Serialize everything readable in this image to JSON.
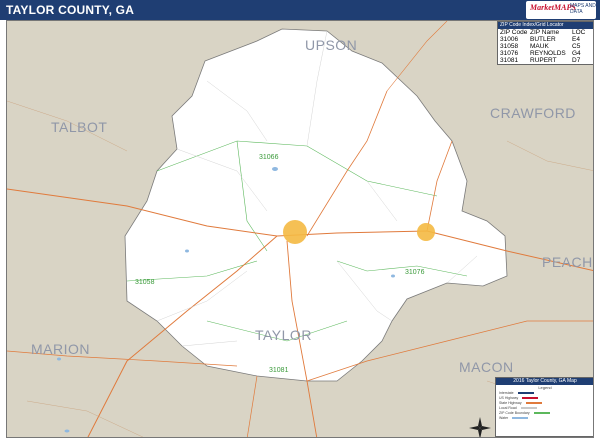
{
  "header": {
    "title": "TAYLOR COUNTY, GA"
  },
  "logo": {
    "text": "MarketMAPS",
    "subtext": "MAPS AND DATA"
  },
  "neighbors": [
    {
      "id": "upson",
      "name": "UPSON"
    },
    {
      "id": "talbot",
      "name": "TALBOT"
    },
    {
      "id": "crawford",
      "name": "CRAWFORD"
    },
    {
      "id": "peach",
      "name": "PEACH"
    },
    {
      "id": "marion",
      "name": "MARION"
    },
    {
      "id": "macon",
      "name": "MACON"
    }
  ],
  "county_label": "TAYLOR",
  "zip_labels": [
    "31066",
    "31058",
    "31076",
    "31081",
    "31076"
  ],
  "zip_table": {
    "title": "ZIP Code Index/Grid Locator",
    "headers": [
      "ZIP Code",
      "ZIP Name",
      "LOC"
    ],
    "rows": [
      [
        "31006",
        "BUTLER",
        "E4"
      ],
      [
        "31058",
        "MAUK",
        "C5"
      ],
      [
        "31076",
        "REYNOLDS",
        "G4"
      ],
      [
        "31081",
        "RUPERT",
        "D7"
      ]
    ]
  },
  "legend": {
    "title": "2016 Taylor County, GA Map",
    "subtitle": "Legend",
    "items": [
      "Interstate",
      "US Highway",
      "State Highway",
      "Local Road",
      "ZIP Code Boundary",
      "Water"
    ]
  },
  "colors": {
    "header": "#1f3e73",
    "county": "#ffffff",
    "neighbor": "#d9d4c5",
    "road": "#e07a3c",
    "zip": "#5cb85c",
    "water": "#8fb8e0",
    "city": "#f4b942"
  }
}
